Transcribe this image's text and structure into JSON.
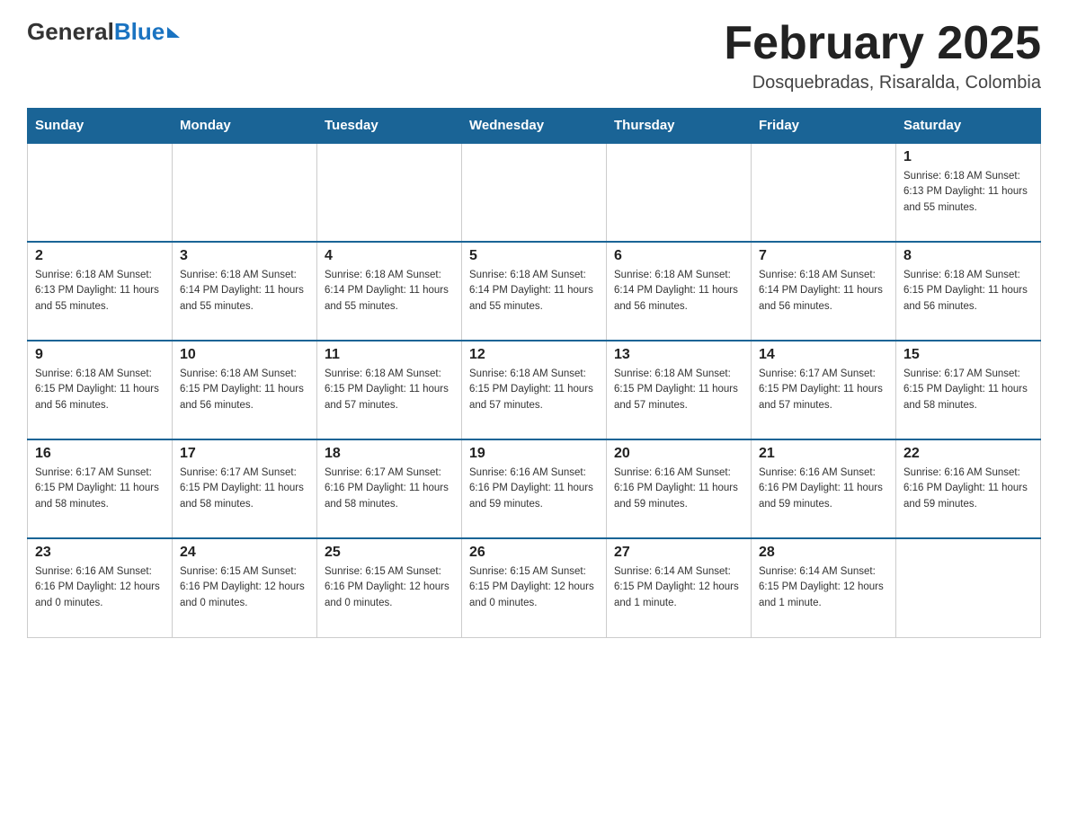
{
  "header": {
    "logo_line1_black": "General",
    "logo_line1_blue": "Blue",
    "calendar_title": "February 2025",
    "calendar_subtitle": "Dosquebradas, Risaralda, Colombia"
  },
  "days_of_week": [
    "Sunday",
    "Monday",
    "Tuesday",
    "Wednesday",
    "Thursday",
    "Friday",
    "Saturday"
  ],
  "weeks": [
    {
      "days": [
        {
          "number": "",
          "info": ""
        },
        {
          "number": "",
          "info": ""
        },
        {
          "number": "",
          "info": ""
        },
        {
          "number": "",
          "info": ""
        },
        {
          "number": "",
          "info": ""
        },
        {
          "number": "",
          "info": ""
        },
        {
          "number": "1",
          "info": "Sunrise: 6:18 AM\nSunset: 6:13 PM\nDaylight: 11 hours\nand 55 minutes."
        }
      ]
    },
    {
      "days": [
        {
          "number": "2",
          "info": "Sunrise: 6:18 AM\nSunset: 6:13 PM\nDaylight: 11 hours\nand 55 minutes."
        },
        {
          "number": "3",
          "info": "Sunrise: 6:18 AM\nSunset: 6:14 PM\nDaylight: 11 hours\nand 55 minutes."
        },
        {
          "number": "4",
          "info": "Sunrise: 6:18 AM\nSunset: 6:14 PM\nDaylight: 11 hours\nand 55 minutes."
        },
        {
          "number": "5",
          "info": "Sunrise: 6:18 AM\nSunset: 6:14 PM\nDaylight: 11 hours\nand 55 minutes."
        },
        {
          "number": "6",
          "info": "Sunrise: 6:18 AM\nSunset: 6:14 PM\nDaylight: 11 hours\nand 56 minutes."
        },
        {
          "number": "7",
          "info": "Sunrise: 6:18 AM\nSunset: 6:14 PM\nDaylight: 11 hours\nand 56 minutes."
        },
        {
          "number": "8",
          "info": "Sunrise: 6:18 AM\nSunset: 6:15 PM\nDaylight: 11 hours\nand 56 minutes."
        }
      ]
    },
    {
      "days": [
        {
          "number": "9",
          "info": "Sunrise: 6:18 AM\nSunset: 6:15 PM\nDaylight: 11 hours\nand 56 minutes."
        },
        {
          "number": "10",
          "info": "Sunrise: 6:18 AM\nSunset: 6:15 PM\nDaylight: 11 hours\nand 56 minutes."
        },
        {
          "number": "11",
          "info": "Sunrise: 6:18 AM\nSunset: 6:15 PM\nDaylight: 11 hours\nand 57 minutes."
        },
        {
          "number": "12",
          "info": "Sunrise: 6:18 AM\nSunset: 6:15 PM\nDaylight: 11 hours\nand 57 minutes."
        },
        {
          "number": "13",
          "info": "Sunrise: 6:18 AM\nSunset: 6:15 PM\nDaylight: 11 hours\nand 57 minutes."
        },
        {
          "number": "14",
          "info": "Sunrise: 6:17 AM\nSunset: 6:15 PM\nDaylight: 11 hours\nand 57 minutes."
        },
        {
          "number": "15",
          "info": "Sunrise: 6:17 AM\nSunset: 6:15 PM\nDaylight: 11 hours\nand 58 minutes."
        }
      ]
    },
    {
      "days": [
        {
          "number": "16",
          "info": "Sunrise: 6:17 AM\nSunset: 6:15 PM\nDaylight: 11 hours\nand 58 minutes."
        },
        {
          "number": "17",
          "info": "Sunrise: 6:17 AM\nSunset: 6:15 PM\nDaylight: 11 hours\nand 58 minutes."
        },
        {
          "number": "18",
          "info": "Sunrise: 6:17 AM\nSunset: 6:16 PM\nDaylight: 11 hours\nand 58 minutes."
        },
        {
          "number": "19",
          "info": "Sunrise: 6:16 AM\nSunset: 6:16 PM\nDaylight: 11 hours\nand 59 minutes."
        },
        {
          "number": "20",
          "info": "Sunrise: 6:16 AM\nSunset: 6:16 PM\nDaylight: 11 hours\nand 59 minutes."
        },
        {
          "number": "21",
          "info": "Sunrise: 6:16 AM\nSunset: 6:16 PM\nDaylight: 11 hours\nand 59 minutes."
        },
        {
          "number": "22",
          "info": "Sunrise: 6:16 AM\nSunset: 6:16 PM\nDaylight: 11 hours\nand 59 minutes."
        }
      ]
    },
    {
      "days": [
        {
          "number": "23",
          "info": "Sunrise: 6:16 AM\nSunset: 6:16 PM\nDaylight: 12 hours\nand 0 minutes."
        },
        {
          "number": "24",
          "info": "Sunrise: 6:15 AM\nSunset: 6:16 PM\nDaylight: 12 hours\nand 0 minutes."
        },
        {
          "number": "25",
          "info": "Sunrise: 6:15 AM\nSunset: 6:16 PM\nDaylight: 12 hours\nand 0 minutes."
        },
        {
          "number": "26",
          "info": "Sunrise: 6:15 AM\nSunset: 6:15 PM\nDaylight: 12 hours\nand 0 minutes."
        },
        {
          "number": "27",
          "info": "Sunrise: 6:14 AM\nSunset: 6:15 PM\nDaylight: 12 hours\nand 1 minute."
        },
        {
          "number": "28",
          "info": "Sunrise: 6:14 AM\nSunset: 6:15 PM\nDaylight: 12 hours\nand 1 minute."
        },
        {
          "number": "",
          "info": ""
        }
      ]
    }
  ]
}
